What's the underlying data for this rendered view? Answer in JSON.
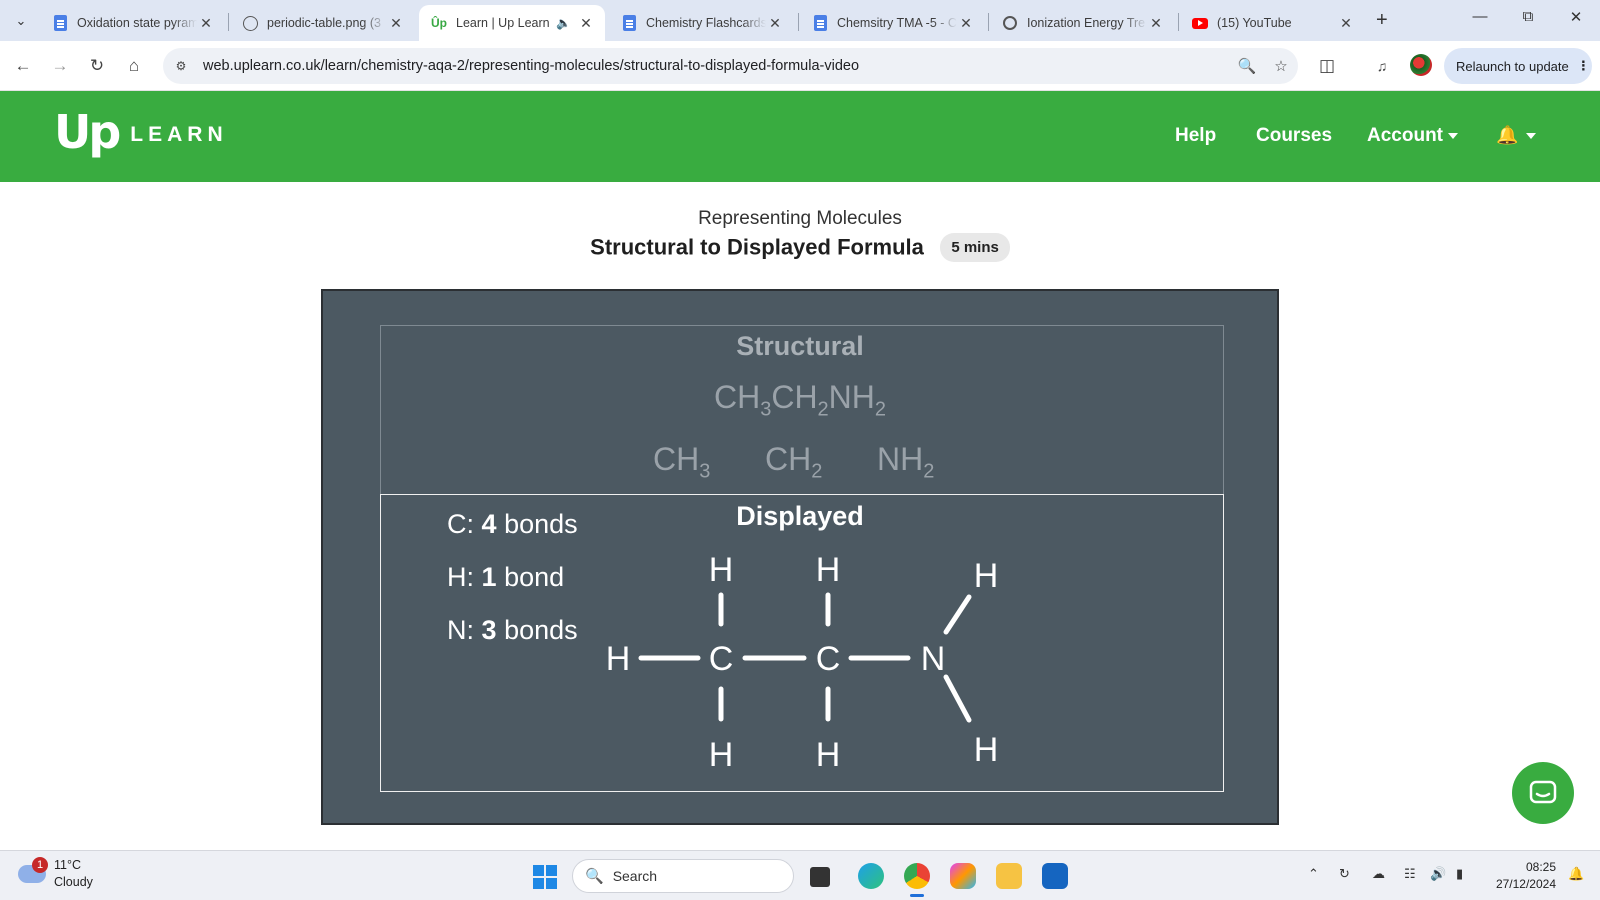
{
  "browser": {
    "tabs": [
      {
        "title": "Oxidation state pyramid",
        "icon": "docs-icon"
      },
      {
        "title": "periodic-table.png (3",
        "icon": "globe-icon"
      },
      {
        "title": "Learn | Up Learn",
        "icon": "uplearn-icon",
        "active": true
      },
      {
        "title": "Chemistry Flashcards",
        "icon": "docs-icon"
      },
      {
        "title": "Chemsitry TMA -5 - C",
        "icon": "docs-icon"
      },
      {
        "title": "Ionization Energy Tre",
        "icon": "openai-icon"
      },
      {
        "title": "(15) YouTube",
        "icon": "youtube-icon"
      }
    ],
    "url": "web.uplearn.co.uk/learn/chemistry-aqa-2/representing-molecules/structural-to-displayed-formula-video",
    "relaunch_label": "Relaunch to update"
  },
  "site": {
    "logo_up": "Up",
    "logo_learn": "LEARN",
    "nav": {
      "help": "Help",
      "courses": "Courses",
      "account": "Account"
    }
  },
  "lesson": {
    "module": "Representing Molecules",
    "title": "Structural to Displayed Formula",
    "duration": "5 mins"
  },
  "video": {
    "structural_heading": "Structural",
    "formula_text": "CH3CH2NH2",
    "fragments": [
      "CH3",
      "CH2",
      "NH2"
    ],
    "displayed_heading": "Displayed",
    "rules": [
      {
        "element": "C:",
        "count": "4",
        "unit": "bonds"
      },
      {
        "element": "H:",
        "count": "1",
        "unit": "bond"
      },
      {
        "element": "N:",
        "count": "3",
        "unit": "bonds"
      }
    ],
    "atoms": {
      "h": "H",
      "c": "C",
      "n": "N"
    }
  },
  "taskbar": {
    "weather_badge": "1",
    "temperature": "11°C",
    "condition": "Cloudy",
    "search_label": "Search",
    "time": "08:25",
    "date": "27/12/2024"
  }
}
